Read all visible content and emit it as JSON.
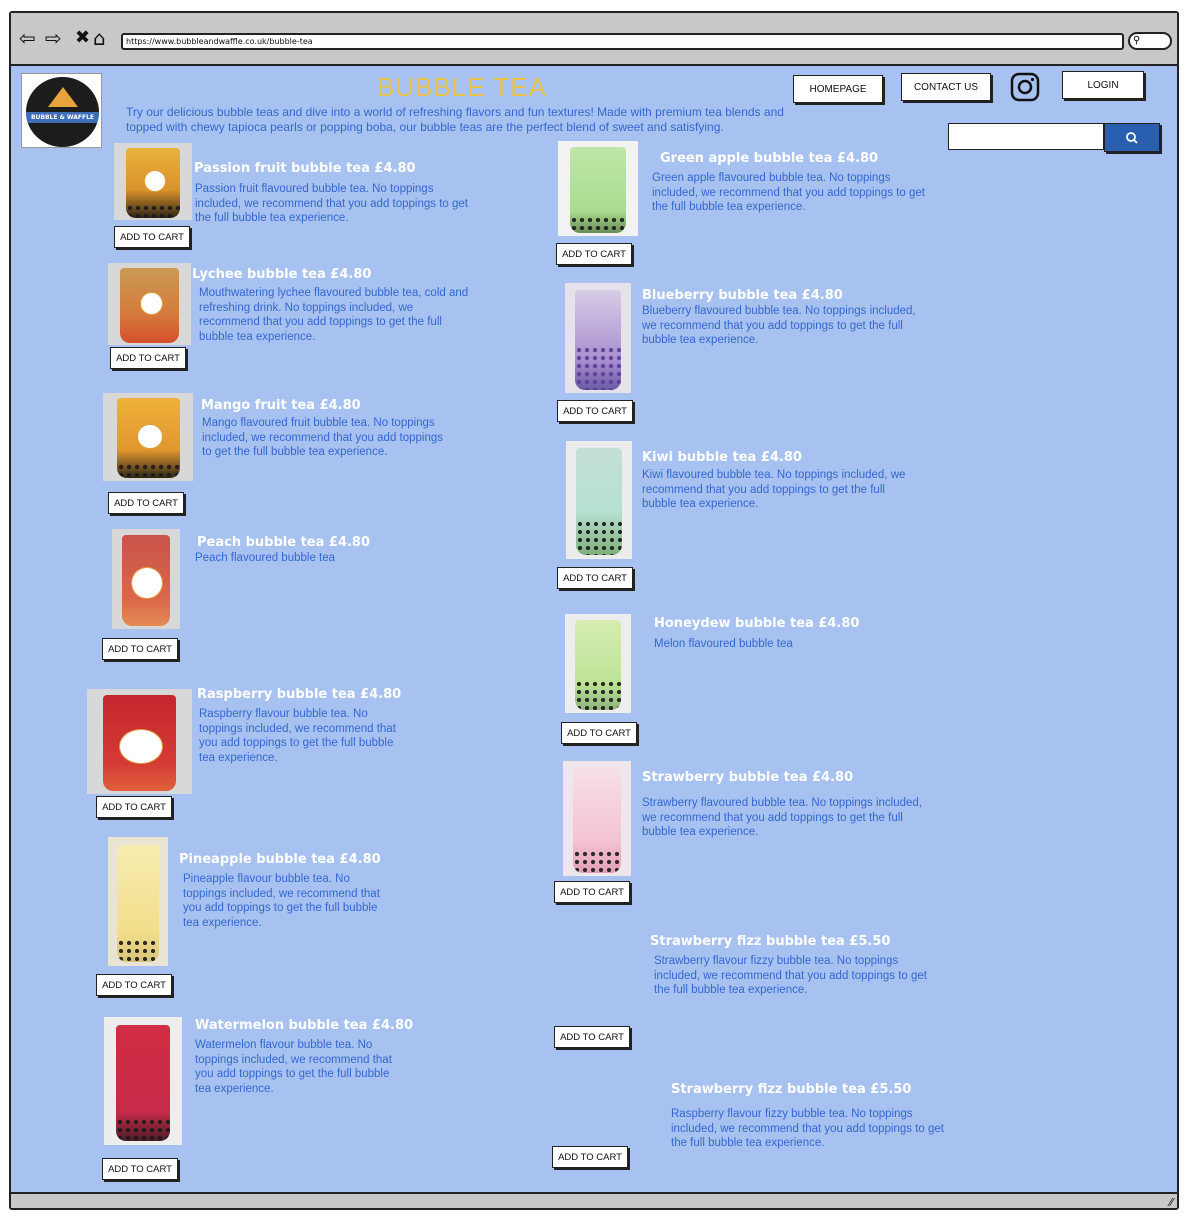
{
  "browser": {
    "url": "https://www.bubbleandwaffle.co.uk/bubble-tea",
    "back_icon": "back-arrow-icon",
    "forward_icon": "forward-arrow-icon",
    "close_icon": "close-icon",
    "home_icon": "home-icon"
  },
  "logo": {
    "text": "BUBBLE & WAFFLE"
  },
  "header": {
    "title": "BUBBLE TEA",
    "intro": "Try our delicious bubble teas and dive into a world of refreshing flavors and fun textures! Made with premium tea blends and topped with chewy tapioca pearls or popping boba, our bubble teas are the perfect blend of sweet and satisfying."
  },
  "nav": {
    "homepage": "HOMEPAGE",
    "contact": "CONTACT US",
    "login": "LOGIN",
    "instagram_icon": "instagram-icon"
  },
  "search": {
    "placeholder": "",
    "icon": "search-icon"
  },
  "cart_label": "ADD TO CART",
  "products": [
    {
      "name": "Passion fruit bubble tea £4.80",
      "desc": "Passion fruit flavoured bubble tea. No toppings included, we recommend that you add toppings to get the full bubble tea experience."
    },
    {
      "name": "Lychee bubble tea  £4.80",
      "desc": "Mouthwatering lychee flavoured bubble tea, cold and refreshing drink. No toppings included, we recommend that you add toppings to get the full bubble tea experience."
    },
    {
      "name": "Mango fruit tea £4.80",
      "desc": "Mango flavoured fruit bubble tea. No toppings included, we recommend that you add toppings to get the full bubble tea experience."
    },
    {
      "name": "Peach bubble tea £4.80",
      "desc": "Peach flavoured bubble tea"
    },
    {
      "name": "Raspberry bubble tea £4.80",
      "desc": "Raspberry flavour bubble tea. No toppings included, we recommend that you add toppings to get the full bubble tea experience."
    },
    {
      "name": "Pineapple bubble tea £4.80",
      "desc": "Pineapple flavour bubble tea. No toppings included, we recommend that you add toppings to get the full bubble tea experience."
    },
    {
      "name": "Watermelon  bubble tea £4.80",
      "desc": "Watermelon flavour bubble tea. No toppings included, we recommend that you add toppings to get the full bubble tea experience."
    },
    {
      "name": "Green apple bubble tea  £4.80",
      "desc": "Green apple flavoured bubble tea. No toppings included, we recommend that you add toppings to get the full bubble tea experience."
    },
    {
      "name": "Blueberry bubble tea £4.80",
      "desc": "Blueberry flavoured bubble tea. No toppings included, we recommend that you add toppings to get the full bubble tea experience."
    },
    {
      "name": "Kiwi bubble tea £4.80",
      "desc": "Kiwi flavoured bubble tea. No toppings included, we recommend that you add toppings to get the full bubble tea experience."
    },
    {
      "name": "Honeydew bubble tea £4.80",
      "desc": "Melon flavoured bubble tea"
    },
    {
      "name": "Strawberry bubble tea £4.80",
      "desc": "Strawberry flavoured bubble tea. No toppings included, we recommend that you add toppings to get the full bubble tea experience."
    },
    {
      "name": "Strawberry fizz bubble tea £5.50",
      "desc": "Strawberry flavour fizzy bubble tea. No toppings included, we recommend that you add toppings to get the full bubble tea experience."
    },
    {
      "name": "Strawberry fizz bubble tea £5.50",
      "desc": "Raspberry flavour fizzy bubble tea. No toppings included, we recommend that you add toppings to get the full bubble tea experience."
    }
  ],
  "colors": {
    "background": "#a7c2f0",
    "title": "#e9c34a",
    "text": "#3467cf",
    "search_button": "#2a5fb0"
  }
}
